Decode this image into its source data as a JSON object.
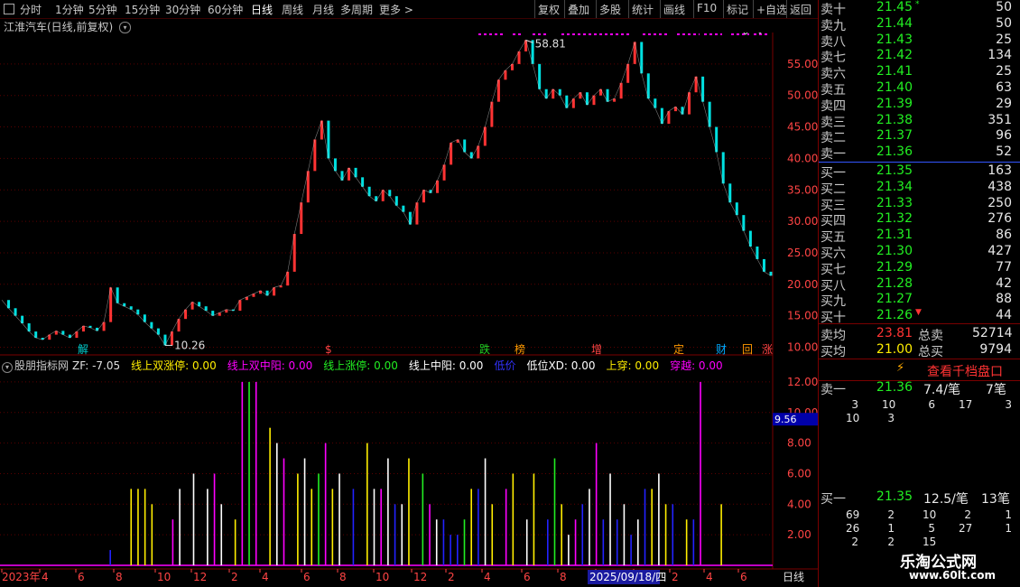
{
  "toolbar": {
    "left_items": [
      "分时",
      "1分钟",
      "5分钟",
      "15分钟",
      "30分钟",
      "60分钟",
      "日线",
      "周线",
      "月线",
      "多周期",
      "更多 >"
    ],
    "active_item": "日线",
    "right_items": [
      "复权",
      "叠加",
      "多股",
      "统计",
      "画线",
      "F10",
      "标记",
      "+自选",
      "返回"
    ]
  },
  "chart_title": "江淮汽车(日线,前复权)",
  "chart_data": [
    {
      "type": "line",
      "title": "江淮汽车(日线,前复权)",
      "y_ticks": [
        "55.00",
        "50.00",
        "45.00",
        "40.00",
        "35.00",
        "30.00",
        "25.00",
        "20.00",
        "15.00",
        "10.00"
      ],
      "ylim": [
        9.5,
        60
      ],
      "annotations": [
        {
          "text": "58.81",
          "kind": "high"
        },
        {
          "text": "10.26",
          "kind": "low"
        }
      ],
      "event_markers": [
        {
          "text": "解",
          "color": "#00cccc"
        },
        {
          "text": "$",
          "color": "#ff4444"
        },
        {
          "text": "跌",
          "color": "#22cc22"
        },
        {
          "text": "榜",
          "color": "#ff9900"
        },
        {
          "text": "增",
          "color": "#ff4444"
        },
        {
          "text": "定",
          "color": "#ff9900"
        },
        {
          "text": "财",
          "color": "#00aaff"
        },
        {
          "text": "回",
          "color": "#ff9900"
        },
        {
          "text": "涨",
          "color": "#ff4444"
        }
      ],
      "series": [
        {
          "values": [
            17.5,
            16.2,
            15.0,
            13.8,
            12.5,
            11.5,
            11.2,
            12.0,
            12.6,
            12.0,
            11.5,
            12.5,
            13.4,
            13.1,
            12.6,
            14.0,
            19.5,
            17.0,
            16.5,
            16.0,
            15.2,
            14.0,
            13.0,
            12.0,
            10.3,
            12.5,
            14.5,
            16.0,
            17.2,
            16.5,
            15.8,
            15.0,
            15.5,
            16.0,
            15.8,
            17.5,
            18.0,
            18.5,
            19.0,
            18.2,
            19.5,
            19.8,
            22.0,
            28.0,
            33.0,
            38.0,
            43.0,
            46.0,
            40.0,
            38.0,
            36.5,
            38.5,
            37.0,
            35.5,
            34.0,
            33.2,
            35.0,
            34.0,
            32.5,
            31.5,
            29.5,
            33.0,
            35.0,
            34.5,
            36.5,
            39.0,
            42.5,
            43.0,
            41.0,
            40.0,
            42.0,
            45.0,
            49.0,
            52.5,
            54.0,
            55.0,
            57.0,
            58.8,
            55.0,
            51.0,
            49.5,
            51.0,
            50.0,
            48.0,
            49.5,
            50.5,
            48.5,
            50.0,
            51.0,
            49.0,
            49.5,
            52.0,
            55.0,
            58.5,
            53.5,
            49.5,
            48.0,
            45.5,
            47.5,
            48.2,
            47.0,
            50.5,
            53.0,
            49.0,
            45.0,
            41.0,
            36.0,
            33.0,
            31.0,
            28.5,
            26.0,
            24.0,
            22.0,
            21.36
          ]
        }
      ]
    },
    {
      "type": "bar",
      "title": "股朋指标网",
      "y_ticks": [
        "12.00",
        "10.00",
        "8.00",
        "6.00",
        "4.00",
        "2.00"
      ],
      "ylim": [
        0,
        13
      ],
      "current_value_label": "9.56",
      "series": [
        {
          "name": "线上双涨停",
          "color": "#ffee00",
          "values": [
            [
              18,
              5
            ],
            [
              19,
              5
            ],
            [
              20,
              5
            ],
            [
              21,
              4
            ],
            [
              33,
              3
            ],
            [
              38,
              9
            ],
            [
              42,
              6
            ],
            [
              44,
              5
            ],
            [
              47,
              5
            ],
            [
              52,
              8
            ],
            [
              58,
              7
            ],
            [
              67,
              5
            ],
            [
              70,
              4
            ],
            [
              73,
              6
            ],
            [
              76,
              6
            ],
            [
              80,
              4
            ],
            [
              93,
              5
            ],
            [
              95,
              4
            ],
            [
              98,
              3
            ],
            [
              103,
              4
            ]
          ]
        },
        {
          "name": "线上双中阳",
          "color": "#ff00ff",
          "values": [
            [
              24,
              3
            ],
            [
              30,
              6
            ],
            [
              34,
              12
            ],
            [
              36,
              12
            ],
            [
              40,
              7
            ],
            [
              46,
              8
            ],
            [
              54,
              5
            ],
            [
              61,
              4
            ],
            [
              72,
              5
            ],
            [
              82,
              3
            ],
            [
              85,
              8
            ],
            [
              100,
              12
            ]
          ]
        },
        {
          "name": "线上涨停",
          "color": "#22ee22",
          "values": [
            [
              35,
              12
            ],
            [
              45,
              6
            ],
            [
              60,
              6
            ],
            [
              66,
              3
            ],
            [
              79,
              7
            ]
          ]
        },
        {
          "name": "线上中阳",
          "color": "#ffffff",
          "values": [
            [
              25,
              5
            ],
            [
              27,
              6
            ],
            [
              29,
              5
            ],
            [
              31,
              4
            ],
            [
              39,
              8
            ],
            [
              43,
              7
            ],
            [
              48,
              6
            ],
            [
              53,
              5
            ],
            [
              55,
              7
            ],
            [
              57,
              4
            ],
            [
              62,
              3
            ],
            [
              69,
              7
            ],
            [
              75,
              3
            ],
            [
              81,
              2
            ],
            [
              84,
              5
            ],
            [
              87,
              6
            ],
            [
              89,
              4
            ],
            [
              91,
              3
            ],
            [
              94,
              6
            ]
          ]
        },
        {
          "name": "低价",
          "color": "#2222ff",
          "values": [
            [
              15,
              1
            ],
            [
              50,
              5
            ],
            [
              56,
              4
            ],
            [
              63,
              3
            ],
            [
              64,
              2
            ],
            [
              65,
              2
            ],
            [
              68,
              5
            ],
            [
              78,
              3
            ],
            [
              83,
              4
            ],
            [
              86,
              3
            ],
            [
              88,
              3
            ],
            [
              90,
              2
            ],
            [
              92,
              5
            ],
            [
              96,
              4
            ],
            [
              99,
              3
            ]
          ]
        }
      ]
    }
  ],
  "indicator": {
    "name": "股朋指标网",
    "zf_label": "ZF: -7.05",
    "items": [
      {
        "text": "线上双涨停: 0.00",
        "color": "#ffee00"
      },
      {
        "text": "线上双中阳: 0.00",
        "color": "#ff00ff"
      },
      {
        "text": "线上涨停: 0.00",
        "color": "#22ee22"
      },
      {
        "text": "线上中阳: 0.00",
        "color": "#ffffff"
      },
      {
        "text": "低价",
        "color": "#3333ff"
      },
      {
        "text": "低位XD: 0.00",
        "color": "#ffffff"
      },
      {
        "text": "上穿: 0.00",
        "color": "#ffee00"
      },
      {
        "text": "穿越: 0.00",
        "color": "#ff00ff"
      }
    ]
  },
  "x_axis": {
    "labels": [
      "2023年",
      "4",
      "6",
      "8",
      "10",
      "12",
      "2",
      "4",
      "6",
      "8",
      "10",
      "12",
      "2",
      "4",
      "6",
      "8",
      "10",
      "12",
      "2",
      "4",
      "6"
    ],
    "cursor_date": "2025/09/18/四",
    "period_label": "日线"
  },
  "order_book": {
    "asks": [
      {
        "label": "卖十",
        "price": "21.45",
        "vol": "50",
        "mark": "*"
      },
      {
        "label": "卖九",
        "price": "21.44",
        "vol": "50"
      },
      {
        "label": "卖八",
        "price": "21.43",
        "vol": "25"
      },
      {
        "label": "卖七",
        "price": "21.42",
        "vol": "134"
      },
      {
        "label": "卖六",
        "price": "21.41",
        "vol": "25"
      },
      {
        "label": "卖五",
        "price": "21.40",
        "vol": "63"
      },
      {
        "label": "卖四",
        "price": "21.39",
        "vol": "29"
      },
      {
        "label": "卖三",
        "price": "21.38",
        "vol": "351"
      },
      {
        "label": "卖二",
        "price": "21.37",
        "vol": "96"
      },
      {
        "label": "卖一",
        "price": "21.36",
        "vol": "52"
      }
    ],
    "bids": [
      {
        "label": "买一",
        "price": "21.35",
        "vol": "163"
      },
      {
        "label": "买二",
        "price": "21.34",
        "vol": "438"
      },
      {
        "label": "买三",
        "price": "21.33",
        "vol": "250"
      },
      {
        "label": "买四",
        "price": "21.32",
        "vol": "276"
      },
      {
        "label": "买五",
        "price": "21.31",
        "vol": "86"
      },
      {
        "label": "买六",
        "price": "21.30",
        "vol": "427"
      },
      {
        "label": "买七",
        "price": "21.29",
        "vol": "77"
      },
      {
        "label": "买八",
        "price": "21.28",
        "vol": "42"
      },
      {
        "label": "买九",
        "price": "21.27",
        "vol": "88"
      },
      {
        "label": "买十",
        "price": "21.26",
        "vol": "44",
        "mark": "▼"
      }
    ],
    "ask_avg_label": "卖均",
    "ask_avg": "23.81",
    "total_ask_label": "总卖",
    "total_ask": "52714",
    "bid_avg_label": "买均",
    "bid_avg": "21.00",
    "total_bid_label": "总买",
    "total_bid": "9794"
  },
  "depth_button": "查看千档盘口",
  "sell_one": {
    "label": "卖一",
    "price": "21.36",
    "per": "7.4/笔",
    "count": "7笔",
    "rows": [
      [
        "3",
        "10",
        "6",
        "17",
        "3"
      ],
      [
        "10",
        "3",
        "",
        "",
        ""
      ]
    ]
  },
  "buy_one": {
    "label": "买一",
    "price": "21.35",
    "per": "12.5/笔",
    "count": "13笔",
    "rows": [
      [
        "69",
        "2",
        "10",
        "2",
        "1"
      ],
      [
        "26",
        "1",
        "5",
        "27",
        "1"
      ],
      [
        "2",
        "2",
        "15",
        "",
        ""
      ]
    ]
  },
  "watermark": {
    "line1": "乐淘公式网",
    "line2": "www.60lt.com"
  }
}
